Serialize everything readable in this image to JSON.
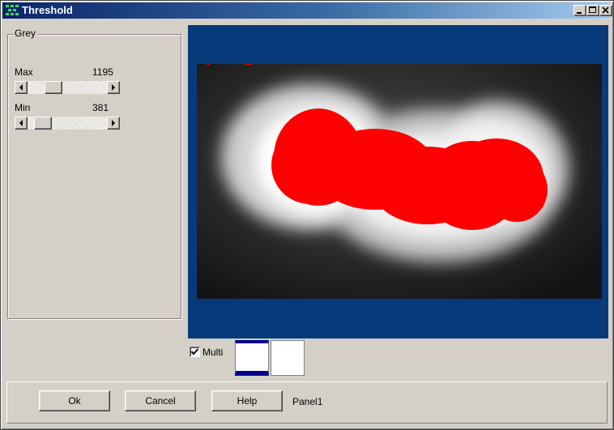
{
  "window": {
    "title": "Threshold",
    "accent": "#0a246a"
  },
  "titlebar_buttons": [
    "minimize-icon",
    "maximize-icon",
    "close-icon"
  ],
  "grey": {
    "legend": "Grey",
    "max": {
      "label": "Max",
      "value": "1195",
      "slider_fraction": 0.28
    },
    "min": {
      "label": "Min",
      "value": "381",
      "slider_fraction": 0.1
    }
  },
  "image": {
    "background_color": "#073a7a",
    "threshold_color": "#ff0000"
  },
  "multi": {
    "label": "Multi",
    "checked": true
  },
  "thumbnails": [
    {
      "selected": true
    },
    {
      "selected": false
    }
  ],
  "buttons": {
    "ok": "Ok",
    "cancel": "Cancel",
    "help": "Help"
  },
  "panel_label": "Panel1"
}
